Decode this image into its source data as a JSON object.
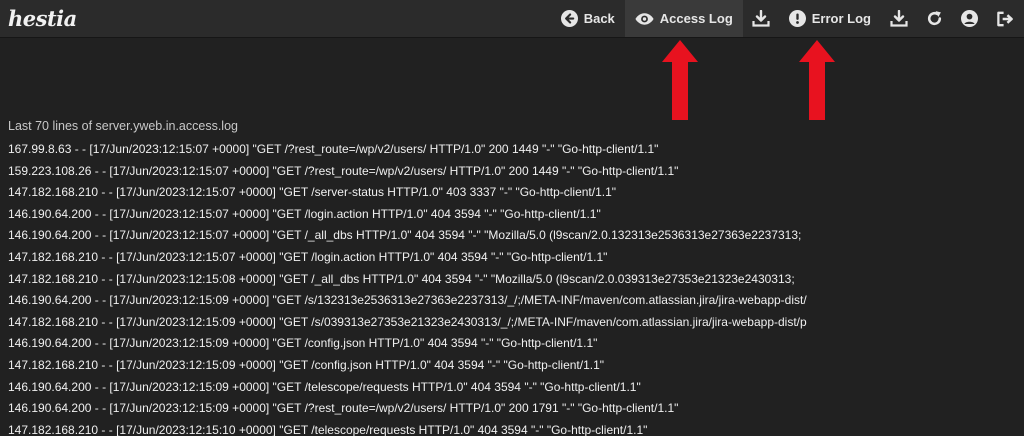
{
  "app": {
    "logo_text": "hestia"
  },
  "toolbar": {
    "back_label": "Back",
    "access_log_label": "Access Log",
    "error_log_label": "Error Log",
    "icons": [
      "arrow-left-circle-icon",
      "eye-icon",
      "download-icon",
      "exclamation-circle-icon",
      "download-icon",
      "refresh-icon",
      "user-icon",
      "logout-icon"
    ]
  },
  "colors": {
    "topbar": "#2b2b2b",
    "background": "#212121",
    "active_tab": "#3a3a3a",
    "annotation_arrow": "#e8121f"
  },
  "log": {
    "title": "Last 70 lines of server.yweb.in.access.log",
    "lines": [
      "167.99.8.63 - - [17/Jun/2023:12:15:07 +0000] \"GET /?rest_route=/wp/v2/users/ HTTP/1.0\" 200 1449 \"-\" \"Go-http-client/1.1\"",
      "159.223.108.26 - - [17/Jun/2023:12:15:07 +0000] \"GET /?rest_route=/wp/v2/users/ HTTP/1.0\" 200 1449 \"-\" \"Go-http-client/1.1\"",
      "147.182.168.210 - - [17/Jun/2023:12:15:07 +0000] \"GET /server-status HTTP/1.0\" 403 3337 \"-\" \"Go-http-client/1.1\"",
      "146.190.64.200 - - [17/Jun/2023:12:15:07 +0000] \"GET /login.action HTTP/1.0\" 404 3594 \"-\" \"Go-http-client/1.1\"",
      "146.190.64.200 - - [17/Jun/2023:12:15:07 +0000] \"GET /_all_dbs HTTP/1.0\" 404 3594 \"-\" \"Mozilla/5.0 (l9scan/2.0.132313e2536313e27363e2237313;",
      "147.182.168.210 - - [17/Jun/2023:12:15:07 +0000] \"GET /login.action HTTP/1.0\" 404 3594 \"-\" \"Go-http-client/1.1\"",
      "147.182.168.210 - - [17/Jun/2023:12:15:08 +0000] \"GET /_all_dbs HTTP/1.0\" 404 3594 \"-\" \"Mozilla/5.0 (l9scan/2.0.039313e27353e21323e2430313;",
      "146.190.64.200 - - [17/Jun/2023:12:15:09 +0000] \"GET /s/132313e2536313e27363e2237313/_/;/META-INF/maven/com.atlassian.jira/jira-webapp-dist/",
      "147.182.168.210 - - [17/Jun/2023:12:15:09 +0000] \"GET /s/039313e27353e21323e2430313/_/;/META-INF/maven/com.atlassian.jira/jira-webapp-dist/p",
      "146.190.64.200 - - [17/Jun/2023:12:15:09 +0000] \"GET /config.json HTTP/1.0\" 404 3594 \"-\" \"Go-http-client/1.1\"",
      "147.182.168.210 - - [17/Jun/2023:12:15:09 +0000] \"GET /config.json HTTP/1.0\" 404 3594 \"-\" \"Go-http-client/1.1\"",
      "146.190.64.200 - - [17/Jun/2023:12:15:09 +0000] \"GET /telescope/requests HTTP/1.0\" 404 3594 \"-\" \"Go-http-client/1.1\"",
      "146.190.64.200 - - [17/Jun/2023:12:15:09 +0000] \"GET /?rest_route=/wp/v2/users/ HTTP/1.0\" 200 1791 \"-\" \"Go-http-client/1.1\"",
      "147.182.168.210 - - [17/Jun/2023:12:15:10 +0000] \"GET /telescope/requests HTTP/1.0\" 404 3594 \"-\" \"Go-http-client/1.1\""
    ]
  }
}
